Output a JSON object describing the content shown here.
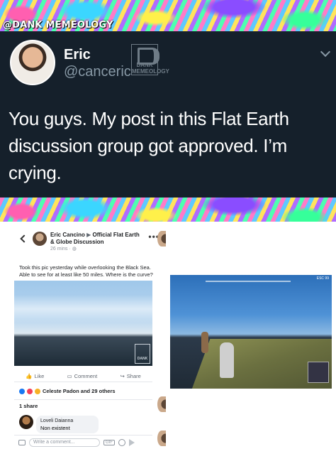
{
  "watermark": "@DANK MEMEOLOGY",
  "tweet": {
    "name": "Eric",
    "handle": "@canceric",
    "logo_text": "DANK MEMEOLOGY",
    "text": "You guys. My post in this Flat Earth discussion group got approved. I’m crying."
  },
  "fb_post": {
    "author": "Eric Cancino",
    "arrow": "▶",
    "group": "Official Flat Earth & Globe Discussion",
    "time": "26 mins · ",
    "text": "Took this pic yesterday while overlooking the Black Sea. Able to see for at least like 50 miles. Where is the curve?",
    "image_logo": "DANK",
    "actions": {
      "like": "Like",
      "comment": "Comment",
      "share": "Share"
    },
    "reactions": "Celeste Padon and 29 others",
    "shares": "1 share",
    "comment": {
      "author": "Loveli Daianna",
      "text": "Non existent"
    },
    "compose_placeholder": "Write a comment...",
    "gif_label": "GIF"
  },
  "game": {
    "hud_text": "ESC 99"
  }
}
